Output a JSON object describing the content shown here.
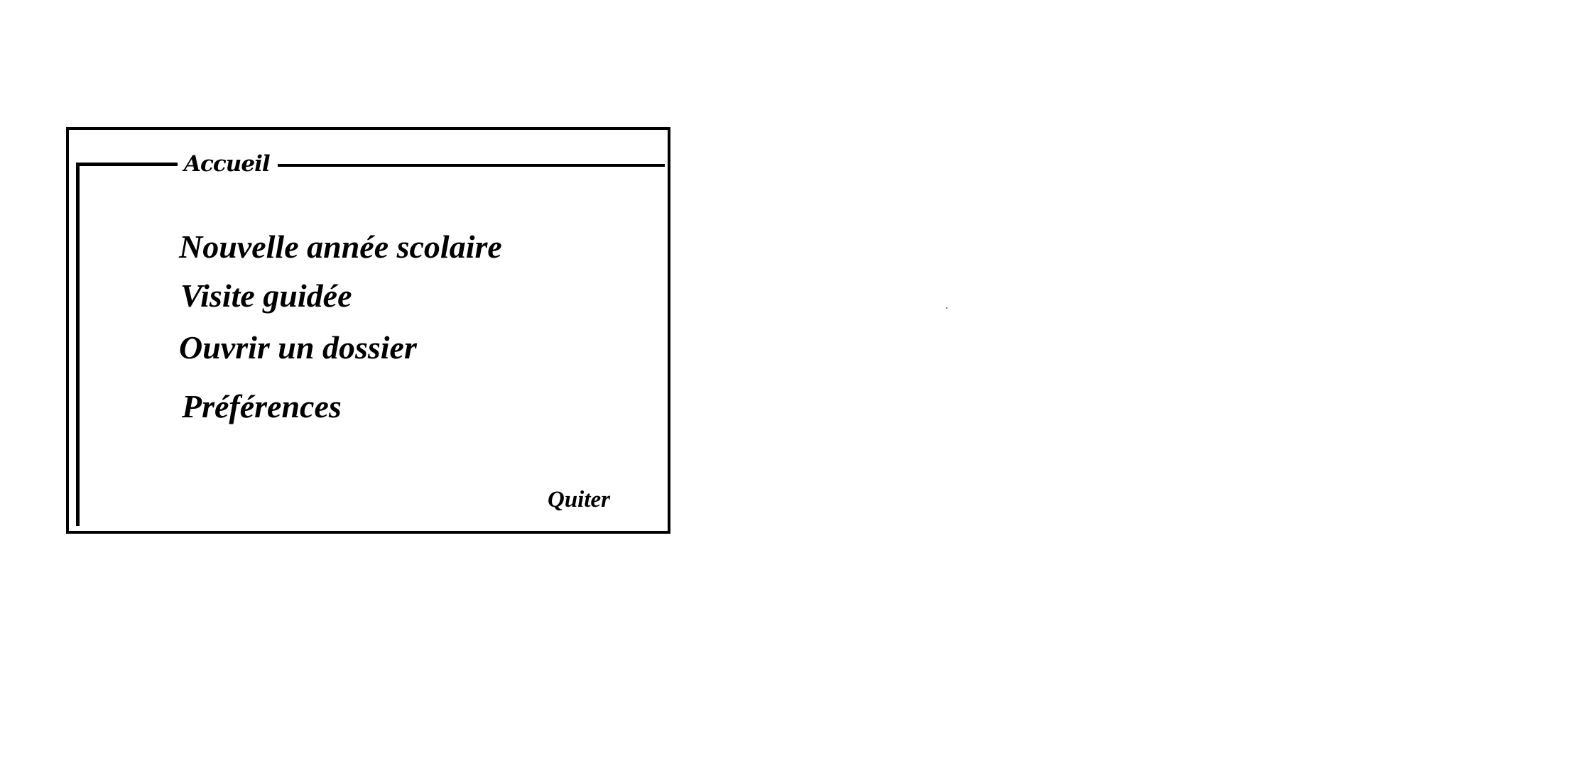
{
  "window": {
    "title": "Accueil"
  },
  "menu": {
    "items": [
      {
        "label": "Nouvelle année scolaire"
      },
      {
        "label": "Visite guidée"
      },
      {
        "label": "Ouvrir un dossier"
      },
      {
        "label": "Préférences"
      }
    ]
  },
  "footer": {
    "quit_label": "Quiter"
  },
  "colors": {
    "background": "#ffffff",
    "foreground": "#000000"
  }
}
